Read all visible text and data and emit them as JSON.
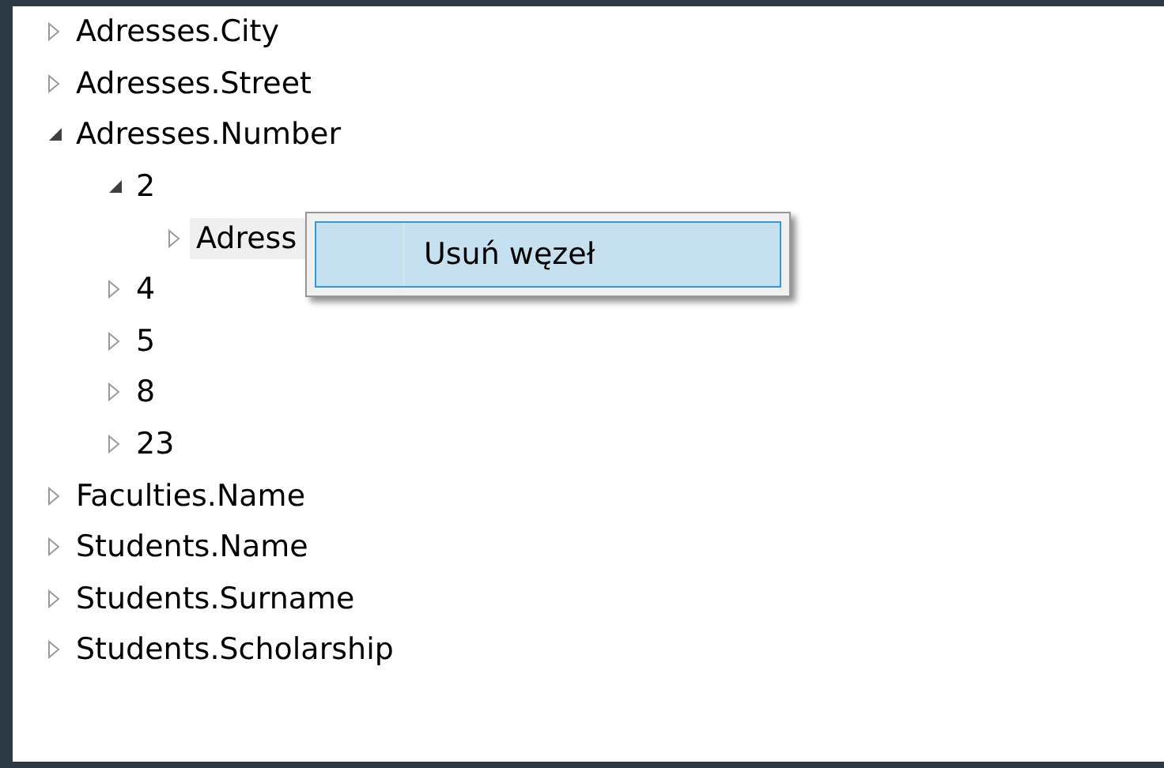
{
  "tree": [
    {
      "label": "Adresses.City",
      "expanded": false,
      "selected": false
    },
    {
      "label": "Adresses.Street",
      "expanded": false,
      "selected": false
    },
    {
      "label": "Adresses.Number",
      "expanded": true,
      "selected": false,
      "children": [
        {
          "label": "2",
          "expanded": true,
          "selected": false,
          "children": [
            {
              "label": "Adress",
              "expanded": false,
              "selected": true
            }
          ]
        },
        {
          "label": "4",
          "expanded": false,
          "selected": false
        },
        {
          "label": "5",
          "expanded": false,
          "selected": false
        },
        {
          "label": "8",
          "expanded": false,
          "selected": false
        },
        {
          "label": "23",
          "expanded": false,
          "selected": false
        }
      ]
    },
    {
      "label": "Faculties.Name",
      "expanded": false,
      "selected": false
    },
    {
      "label": "Students.Name",
      "expanded": false,
      "selected": false
    },
    {
      "label": "Students.Surname",
      "expanded": false,
      "selected": false
    },
    {
      "label": "Students.Scholarship",
      "expanded": false,
      "selected": false
    }
  ],
  "context_menu": {
    "items": [
      {
        "label": "Usuń węzeł",
        "selected": true
      }
    ]
  }
}
